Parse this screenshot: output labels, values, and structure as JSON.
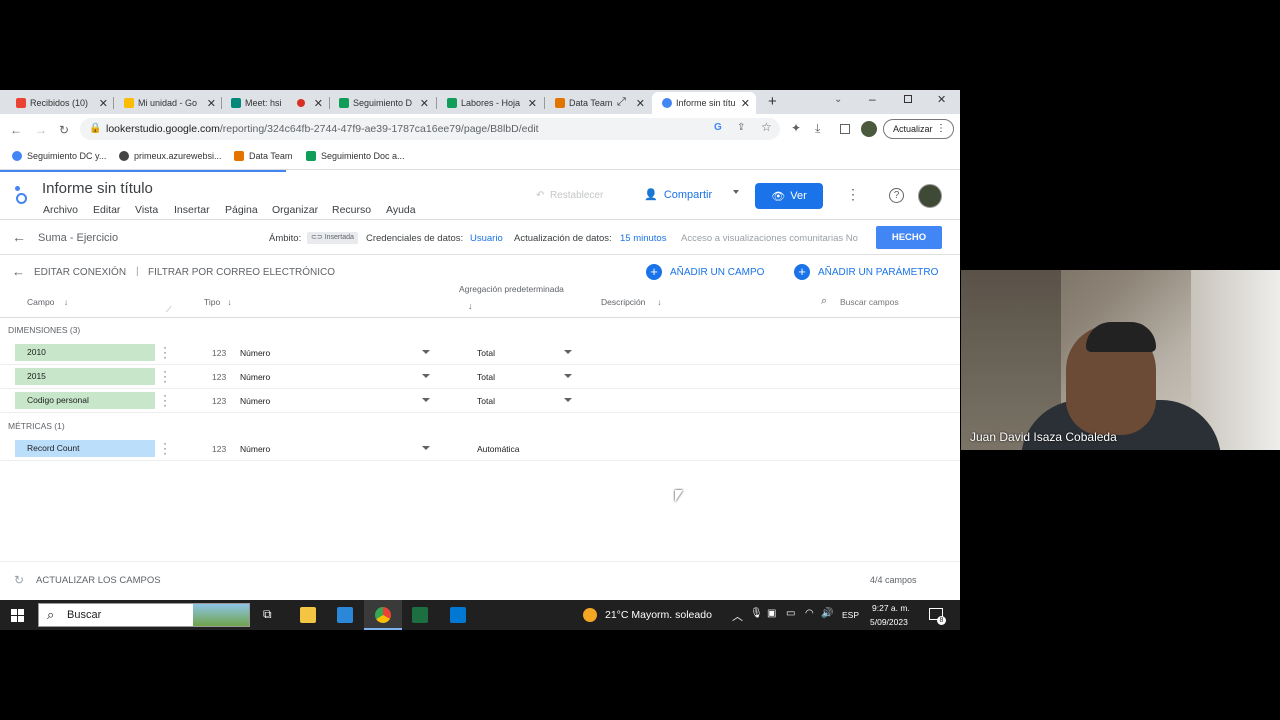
{
  "tabs": [
    {
      "label": "Recibidos (10)",
      "color": "#ea4335"
    },
    {
      "label": "Mi unidad - Go",
      "color": "#fbbc04"
    },
    {
      "label": "Meet: hsi",
      "color": "#00897b"
    },
    {
      "label": "Seguimiento D",
      "color": "#0f9d58"
    },
    {
      "label": "Labores - Hoja",
      "color": "#0f9d58"
    },
    {
      "label": "Data Team",
      "color": "#e37400"
    },
    {
      "label": "Informe sin títu",
      "color": "#4285f4"
    }
  ],
  "address": {
    "host": "lookerstudio.google.com",
    "path": "/reporting/324c64fb-2744-47f9-ae39-1787ca16ee79/page/B8lbD/edit",
    "update_label": "Actualizar"
  },
  "bookmarks": [
    {
      "label": "Seguimiento DC y...",
      "color": "#4285f4"
    },
    {
      "label": "primeux.azurewebsi...",
      "color": "#444444"
    },
    {
      "label": "Data Team",
      "color": "#e37400"
    },
    {
      "label": "Seguimiento Doc a...",
      "color": "#0f9d58"
    }
  ],
  "report": {
    "title": "Informe sin título",
    "menu": [
      "Archivo",
      "Editar",
      "Vista",
      "Insertar",
      "Página",
      "Organizar",
      "Recurso",
      "Ayuda"
    ],
    "reset_label": "Restablecer",
    "share_label": "Compartir",
    "view_label": "Ver"
  },
  "context": {
    "source_name": "Suma - Ejercicio",
    "scope_label": "Ámbito:",
    "scope_badge": "Insertada",
    "credentials_label": "Credenciales de datos:",
    "credentials_value": "Usuario",
    "freshness_label": "Actualización de datos:",
    "freshness_value": "15 minutos",
    "community_label": "Acceso a visualizaciones comunitarias No",
    "done_label": "HECHO"
  },
  "subbar": {
    "edit_connection": "EDITAR CONEXIÓN",
    "filter_email": "FILTRAR POR CORREO ELECTRÓNICO",
    "add_field": "AÑADIR UN CAMPO",
    "add_param": "AÑADIR UN PARÁMETRO"
  },
  "columns": {
    "field": "Campo",
    "type": "Tipo",
    "aggregation": "Agregación predeterminada",
    "description": "Descripción",
    "search_placeholder": "Buscar campos"
  },
  "dimensions": {
    "label": "DIMENSIONES (3)",
    "rows": [
      {
        "name": "2010",
        "type_icon": "123",
        "type": "Número",
        "agg": "Total"
      },
      {
        "name": "2015",
        "type_icon": "123",
        "type": "Número",
        "agg": "Total"
      },
      {
        "name": "Codigo personal",
        "type_icon": "123",
        "type": "Número",
        "agg": "Total"
      }
    ]
  },
  "metrics": {
    "label": "MÉTRICAS (1)",
    "rows": [
      {
        "name": "Record Count",
        "type_icon": "123",
        "type": "Número",
        "agg": "Automática"
      }
    ]
  },
  "footer": {
    "refresh_label": "ACTUALIZAR LOS CAMPOS",
    "count": "4/4 campos"
  },
  "taskbar": {
    "search_label": "Buscar",
    "weather": "21°C  Mayorm. soleado",
    "lang": "ESP",
    "time": "9:27 a. m.",
    "date": "5/09/2023",
    "notif_count": "8"
  },
  "video": {
    "participant": "Juan David Isaza Cobaleda"
  }
}
